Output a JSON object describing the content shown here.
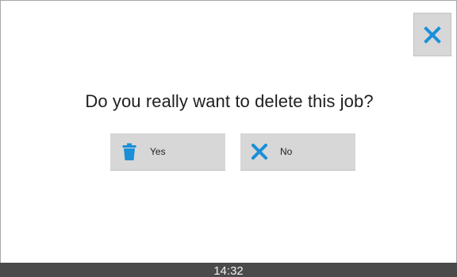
{
  "dialog": {
    "question": "Do you really want to delete this job?",
    "close_icon": "close-icon",
    "yes_button": {
      "label": "Yes",
      "icon": "trash-icon"
    },
    "no_button": {
      "label": "No",
      "icon": "close-icon"
    }
  },
  "status_bar": {
    "time": "14:32"
  },
  "colors": {
    "accent": "#1a8fd8",
    "button_bg": "#d7d7d7",
    "status_bar_bg": "#4a4a4a",
    "text": "#1f1f1f"
  }
}
